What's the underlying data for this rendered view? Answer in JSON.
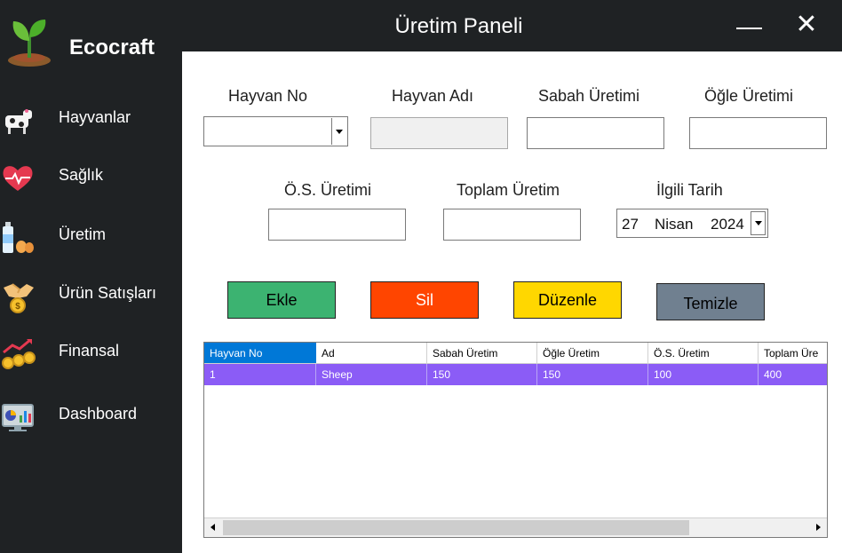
{
  "window": {
    "title": "Üretim Paneli",
    "brand": "Ecocraft",
    "minimize_icon": "minimize-icon",
    "close_label": "✕"
  },
  "sidebar": {
    "items": [
      {
        "label": "Hayvanlar",
        "icon": "cow-icon"
      },
      {
        "label": "Sağlık",
        "icon": "heart-pulse-icon"
      },
      {
        "label": "Üretim",
        "icon": "milk-eggs-icon"
      },
      {
        "label": "Ürün Satışları",
        "icon": "handshake-coin-icon"
      },
      {
        "label": "Finansal",
        "icon": "coins-growth-icon"
      },
      {
        "label": "Dashboard",
        "icon": "monitor-chart-icon"
      }
    ]
  },
  "form": {
    "hayvan_no": {
      "label": "Hayvan No",
      "value": ""
    },
    "hayvan_adi": {
      "label": "Hayvan Adı",
      "value": ""
    },
    "sabah": {
      "label": "Sabah Üretimi",
      "value": ""
    },
    "ogle": {
      "label": "Öğle Üretimi",
      "value": ""
    },
    "os": {
      "label": "Ö.S. Üretimi",
      "value": ""
    },
    "toplam": {
      "label": "Toplam Üretim",
      "value": ""
    },
    "tarih": {
      "label": "İlgili Tarih",
      "day": "27",
      "month": "Nisan",
      "year": "2024"
    }
  },
  "buttons": {
    "ekle": {
      "label": "Ekle",
      "color": "#3cb371"
    },
    "sil": {
      "label": "Sil",
      "color": "#ff4500"
    },
    "duzenle": {
      "label": "Düzenle",
      "color": "#ffd700"
    },
    "temizle": {
      "label": "Temizle",
      "color": "#708090"
    }
  },
  "grid": {
    "columns": [
      "Hayvan No",
      "Ad",
      "Sabah Üretim",
      "Öğle Üretim",
      "Ö.S. Üretim",
      "Toplam Üre"
    ],
    "rows": [
      [
        "1",
        "Sheep",
        "150",
        "150",
        "100",
        "400"
      ]
    ],
    "selected_row_color": "#8b5cf6",
    "header_selected_color": "#0078d7"
  }
}
